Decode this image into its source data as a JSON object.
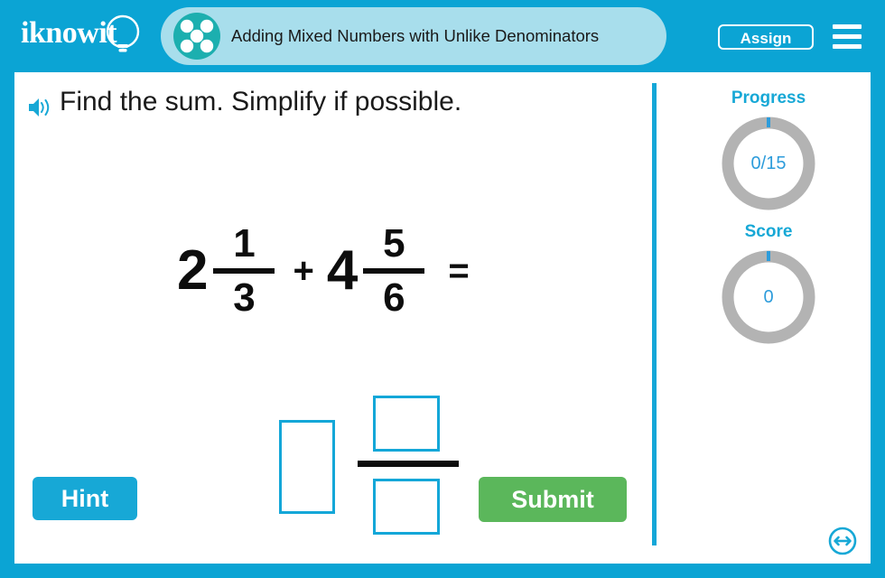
{
  "header": {
    "logo_text": "iknowit",
    "logo_icon": "lightbulb-icon",
    "subject_icon": "five-dot-circle-icon",
    "title": "Adding Mixed Numbers with Unlike Denominators",
    "assign_label": "Assign",
    "menu_icon": "hamburger-menu-icon"
  },
  "question": {
    "audio_icon": "speaker-icon",
    "prompt": "Find the sum. Simplify if possible.",
    "equation": {
      "term1": {
        "whole": "2",
        "numerator": "1",
        "denominator": "3"
      },
      "operator": "+",
      "term2": {
        "whole": "4",
        "numerator": "5",
        "denominator": "6"
      },
      "equals": "="
    }
  },
  "answer": {
    "whole_value": "",
    "whole_placeholder": "",
    "numerator_value": "",
    "numerator_placeholder": "",
    "denominator_value": "",
    "denominator_placeholder": ""
  },
  "actions": {
    "hint_label": "Hint",
    "submit_label": "Submit"
  },
  "sidebar": {
    "progress_label": "Progress",
    "progress_value": "0/15",
    "progress_current": 0,
    "progress_total": 15,
    "score_label": "Score",
    "score_value": "0"
  },
  "footer": {
    "resize_icon": "resize-horizontal-icon"
  },
  "colors": {
    "frame_blue": "#0BA4D4",
    "title_pill": "#A8DEEC",
    "subject_teal": "#1CAFAF",
    "accent_blue": "#17A8D6",
    "submit_green": "#5BB75B",
    "ring_gray": "#B3B3B3",
    "text_dark": "#1a1a1a"
  }
}
